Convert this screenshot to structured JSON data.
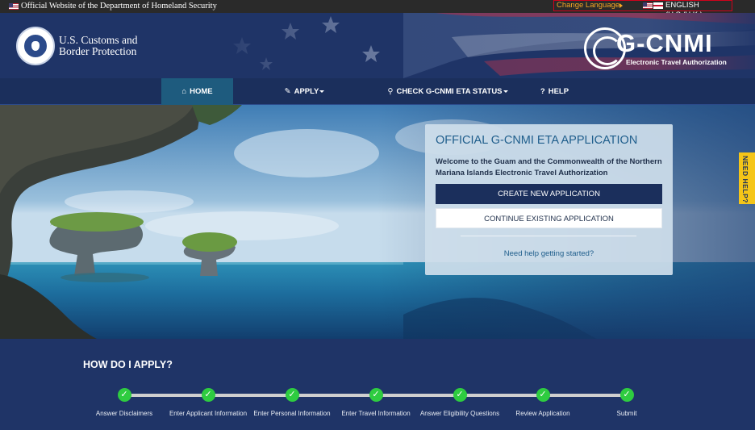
{
  "gov_banner": {
    "official_text": "Official Website of the Department of Homeland Security",
    "change_language": "Change Language",
    "current_language": "ENGLISH (U.S./U.K.)"
  },
  "header": {
    "agency_line1": "U.S. Customs and",
    "agency_line2": "Border Protection",
    "logo_title": "G-CNMI",
    "logo_subtitle": "Electronic Travel Authorization"
  },
  "nav": {
    "items": [
      {
        "label": "HOME",
        "icon": "home-icon",
        "active": true
      },
      {
        "label": "APPLY",
        "icon": "pencil-icon",
        "dropdown": true
      },
      {
        "label": "CHECK G-CNMI ETA STATUS",
        "icon": "search-icon",
        "dropdown": true
      },
      {
        "label": "HELP",
        "icon": "question-icon"
      }
    ]
  },
  "card": {
    "title": "OFFICIAL G-CNMI ETA APPLICATION",
    "welcome": "Welcome to the Guam and the Commonwealth of the Northern Mariana Islands Electronic Travel Authorization",
    "create_button": "CREATE NEW APPLICATION",
    "continue_button": "CONTINUE EXISTING APPLICATION",
    "help_link": "Need help getting started?"
  },
  "need_help_tab": "NEED HELP?",
  "howto": {
    "heading": "HOW DO I APPLY?",
    "steps": [
      {
        "label": "Answer Disclaimers"
      },
      {
        "label": "Enter Applicant Information"
      },
      {
        "label": "Enter Personal Information"
      },
      {
        "label": "Enter Travel Information"
      },
      {
        "label": "Answer Eligibility Questions"
      },
      {
        "label": "Review Application"
      },
      {
        "label": "Submit"
      }
    ],
    "check_glyph": "✓"
  },
  "colors": {
    "navy": "#1b2f5c",
    "header_blue": "#1f3467",
    "active_tab": "#1e5b7e",
    "step_green": "#2ecc40",
    "help_yellow": "#f5c518"
  }
}
